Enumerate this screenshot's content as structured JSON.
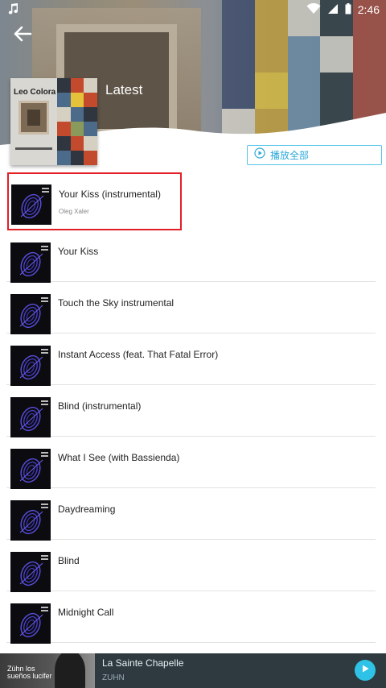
{
  "status_bar": {
    "time": "2:46"
  },
  "header": {
    "title": "Latest",
    "cover_artist": "Leo Colora",
    "play_all_label": "播放全部"
  },
  "tracks": [
    {
      "title": "Your Kiss (instrumental)",
      "artist": "Oleg Xaler",
      "selected": true
    },
    {
      "title": "Your Kiss",
      "artist": ""
    },
    {
      "title": "Touch the Sky instrumental",
      "artist": ""
    },
    {
      "title": "Instant Access (feat. That Fatal Error)",
      "artist": ""
    },
    {
      "title": "Blind (instrumental)",
      "artist": ""
    },
    {
      "title": "What I See (with Bassienda)",
      "artist": ""
    },
    {
      "title": "Daydreaming",
      "artist": ""
    },
    {
      "title": "Blind",
      "artist": ""
    },
    {
      "title": "Midnight Call",
      "artist": ""
    }
  ],
  "mini_player": {
    "title": "La Sainte Chapelle",
    "artist": "ZUHN",
    "cover_text": "Zühn los sueños lucifer"
  },
  "colors": {
    "accent": "#2ec3e6",
    "play_all_border": "#56c6e8",
    "selection_outline": "#e31e24",
    "mini_player_bg": "#2f3a40"
  },
  "icons": {
    "status_left": "music-note-icon",
    "back": "arrow-left-icon",
    "play_all": "play-circle-icon",
    "mini_play": "play-icon"
  }
}
